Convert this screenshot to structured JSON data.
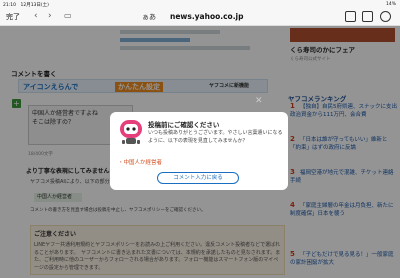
{
  "status": {
    "time": "21:10　12月13日(土)",
    "battery": "14%"
  },
  "browser": {
    "done": "完了",
    "aa": "ぁあ",
    "url": "news.yahoo.co.jp",
    "back_icon": "chevron-left-icon",
    "fwd_icon": "chevron-right-icon"
  },
  "page": {
    "section_title": "コメントを書く",
    "banner_left": "アイコンえらんで",
    "banner_mid": "かんたん設定",
    "banner_right": "ヤフコメに新機能",
    "input_text": "中国人か経営者ですよね\nそこは除すの？",
    "counter": "18/400文字",
    "hint_title": "より丁寧な表現にしてみませんか？",
    "hint_body": "ヤフコメ投稿AIにより、以下の部分を見直してみませんか？",
    "hint_chip": "中国人か経営者",
    "policy": "コメントの書き方を見直す場合は投稿を中止し、ヤフコメポリシーをご確認ください。",
    "notice_title": "ご注意ください",
    "notice_body": "LINEヤフー共通利用規約とヤフコメポリシーをお読みの上ご利用ください。違反コメント投稿者などで選ばれることがあります。　ヤフコメントに書き込まれた文書については、本規約を承諾したものと見なされます。また、ご利用時に他のユーザーからフォローされる場合があります。フォロー機能はスマートフォン版のマイページの設定から管理できます。"
  },
  "right": {
    "title": "くら寿司のかにフェア",
    "sub": "くら寿司公式サイト",
    "ranking_head": "ヤフコメランキング",
    "items": [
      {
        "n": "1",
        "text": "【独自】自民5府県連、スナックに支出 政治資金から111万円、会合費"
      },
      {
        "n": "2",
        "text": "「日本は誰が守ってもいい」維新と「約束」はずの政府に反論"
      },
      {
        "n": "3",
        "text": "福岡空港が地元で混雑、チケット連絡手続"
      },
      {
        "n": "4",
        "text": "「家庭主婦層の年金は月負担、新たに制度確保」日本を襲う"
      },
      {
        "n": "5",
        "text": "「子どもだけで見る見る！」一般家庭の家計困窮が拡大"
      }
    ]
  },
  "modal": {
    "title": "投稿前にご確認ください",
    "body": "いつも投稿ありがとうございます。やさしい言葉遣いになるように、以下の表現を見直してみませんか？",
    "item": "・中国人か経営者",
    "button": "コメント入力に戻る",
    "robot_icon": "robot-icon"
  },
  "colors": {
    "accent": "#1a6fc2",
    "warn": "#d24b1e"
  }
}
